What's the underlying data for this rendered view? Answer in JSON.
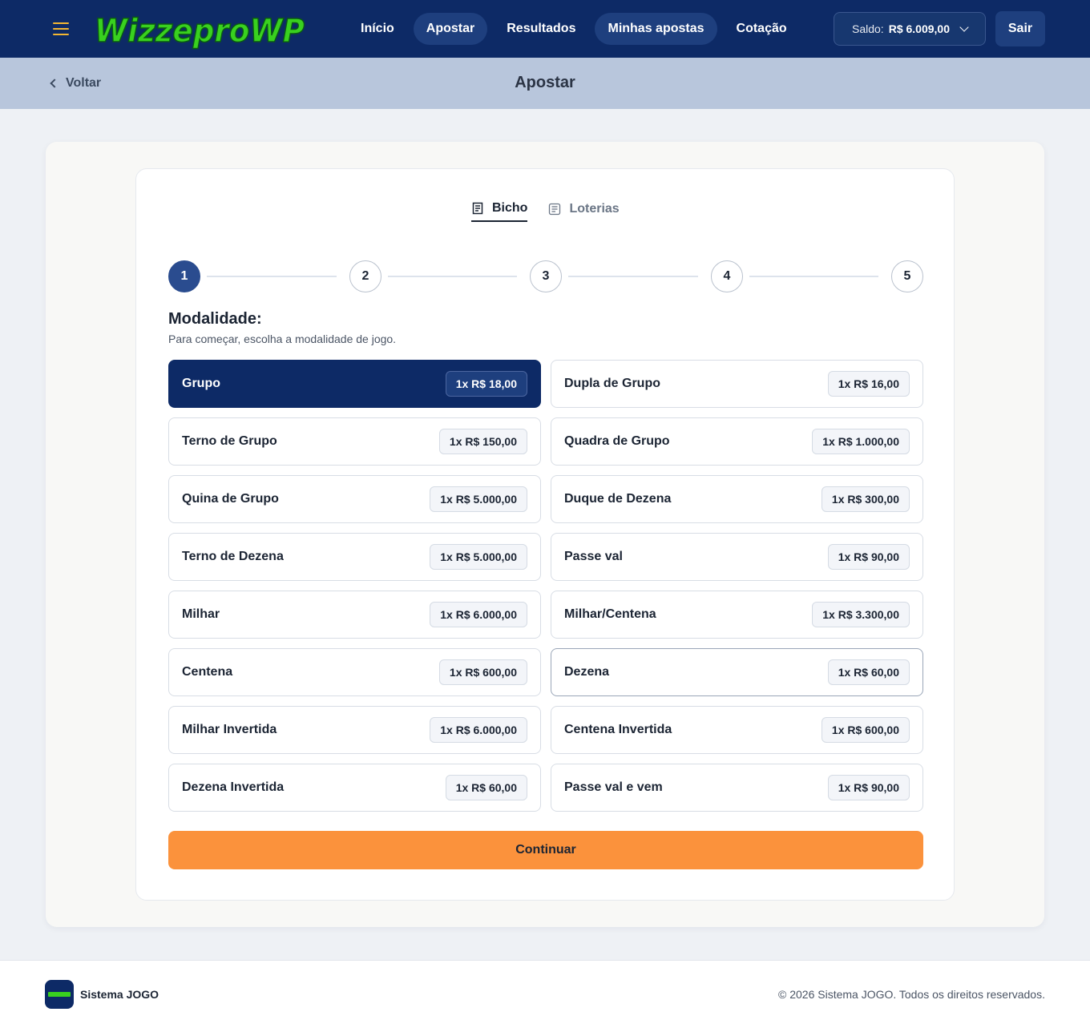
{
  "header": {
    "logo_text": "WizzeproWP",
    "nav": [
      {
        "label": "Início"
      },
      {
        "label": "Apostar"
      },
      {
        "label": "Resultados"
      },
      {
        "label": "Minhas apostas"
      },
      {
        "label": "Cotação"
      }
    ],
    "balance_label": "Saldo:",
    "balance_value": "R$ 6.009,00",
    "logout_label": "Sair",
    "colors": {
      "bar": "#0d2a66",
      "active_pill": "#1e3f7e",
      "logo_green": "#39d11f"
    }
  },
  "subheader": {
    "back_label": "Voltar",
    "title": "Apostar"
  },
  "tabs": [
    {
      "label": "Bicho",
      "icon": "receipt-icon",
      "active": true
    },
    {
      "label": "Loterias",
      "icon": "document-icon",
      "active": false
    }
  ],
  "stepper": {
    "steps": [
      "1",
      "2",
      "3",
      "4",
      "5"
    ],
    "current": 1
  },
  "section": {
    "title": "Modalidade:",
    "subtitle": "Para começar, escolha a modalidade de jogo."
  },
  "options": [
    {
      "name": "Grupo",
      "price": "1x R$ 18,00"
    },
    {
      "name": "Dupla de Grupo",
      "price": "1x R$ 16,00"
    },
    {
      "name": "Terno de Grupo",
      "price": "1x R$ 150,00"
    },
    {
      "name": "Quadra de Grupo",
      "price": "1x R$ 1.000,00"
    },
    {
      "name": "Quina de Grupo",
      "price": "1x R$ 5.000,00"
    },
    {
      "name": "Duque de Dezena",
      "price": "1x R$ 300,00"
    },
    {
      "name": "Terno de Dezena",
      "price": "1x R$ 5.000,00"
    },
    {
      "name": "Passe val",
      "price": "1x R$ 90,00"
    },
    {
      "name": "Milhar",
      "price": "1x R$ 6.000,00"
    },
    {
      "name": "Milhar/Centena",
      "price": "1x R$ 3.300,00"
    },
    {
      "name": "Centena",
      "price": "1x R$ 600,00"
    },
    {
      "name": "Dezena",
      "price": "1x R$ 60,00"
    },
    {
      "name": "Milhar Invertida",
      "price": "1x R$ 6.000,00"
    },
    {
      "name": "Centena Invertida",
      "price": "1x R$ 600,00"
    },
    {
      "name": "Dezena Invertida",
      "price": "1x R$ 60,00"
    },
    {
      "name": "Passe val e vem",
      "price": "1x R$ 90,00"
    }
  ],
  "selected_option": "Grupo",
  "continue_label": "Continuar",
  "accent_color": "#fb923c",
  "footer": {
    "name": "Sistema JOGO",
    "copyright": "© 2026 Sistema JOGO. Todos os direitos reservados."
  }
}
